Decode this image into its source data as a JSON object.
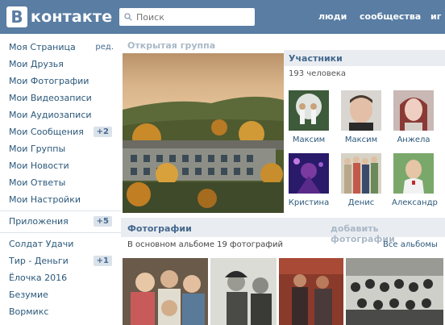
{
  "header": {
    "logo_letter": "В",
    "logo_text": "контакте",
    "search_placeholder": "Поиск",
    "nav": [
      "люди",
      "сообщества",
      "иг"
    ]
  },
  "sidebar": {
    "items": [
      {
        "label": "Моя Страница",
        "extra": "ред."
      },
      {
        "label": "Мои Друзья"
      },
      {
        "label": "Мои Фотографии"
      },
      {
        "label": "Мои Видеозаписи"
      },
      {
        "label": "Мои Аудиозаписи"
      },
      {
        "label": "Мои Сообщения",
        "badge": "+2"
      },
      {
        "label": "Мои Группы"
      },
      {
        "label": "Мои Новости"
      },
      {
        "label": "Мои Ответы"
      },
      {
        "label": "Мои Настройки"
      },
      {
        "label": "Приложения",
        "badge": "+5"
      },
      {
        "label": "Солдат Удачи"
      },
      {
        "label": "Тир - Деньги",
        "badge": "+1"
      },
      {
        "label": "Ёлочка 2016"
      },
      {
        "label": "Безумие"
      },
      {
        "label": "Вормикс"
      }
    ]
  },
  "group": {
    "type_label": "Открытая группа"
  },
  "members": {
    "title": "Участники",
    "count": "193 человека",
    "list": [
      {
        "name": "Максим"
      },
      {
        "name": "Максим"
      },
      {
        "name": "Анжела"
      },
      {
        "name": "Кристина"
      },
      {
        "name": "Денис"
      },
      {
        "name": "Александр"
      }
    ]
  },
  "photos": {
    "title": "Фотографии",
    "add_link": "добавить фотографии",
    "album_info": "В основном альбоме 19 фотографий",
    "all_albums": "Все альбомы"
  },
  "colors": {
    "header_bg": "#597da3",
    "link": "#2b587a",
    "section_bg": "#e9edf1"
  }
}
